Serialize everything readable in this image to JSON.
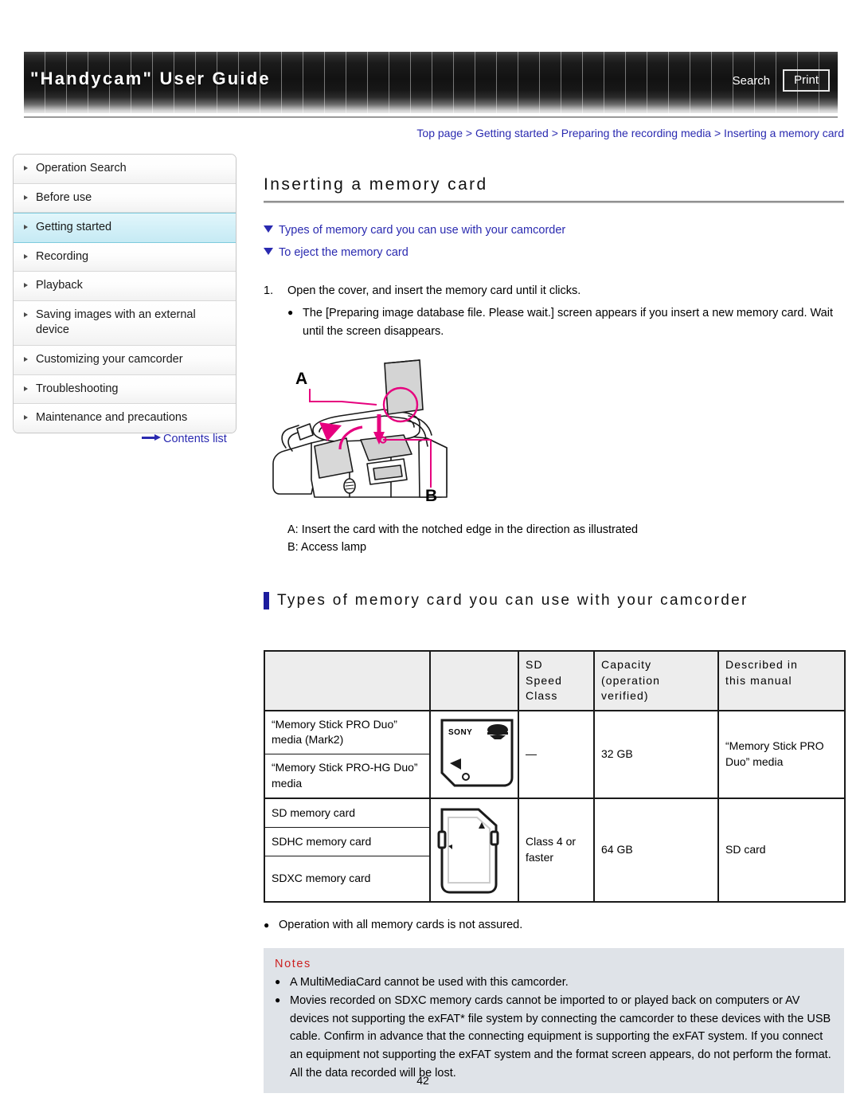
{
  "header": {
    "title": "\"Handycam\" User Guide",
    "search_label": "Search",
    "print_label": "Print"
  },
  "sidebar": {
    "items": [
      {
        "label": "Operation Search",
        "active": false
      },
      {
        "label": "Before use",
        "active": false
      },
      {
        "label": "Getting started",
        "active": true
      },
      {
        "label": "Recording",
        "active": false
      },
      {
        "label": "Playback",
        "active": false
      },
      {
        "label": "Saving images with an external device",
        "active": false
      },
      {
        "label": "Customizing your camcorder",
        "active": false
      },
      {
        "label": "Troubleshooting",
        "active": false
      },
      {
        "label": "Maintenance and precautions",
        "active": false
      }
    ],
    "contents_link": "Contents list"
  },
  "main": {
    "breadcrumb": "Top page > Getting started > Preparing the recording media > Inserting a memory card",
    "page_title": "Inserting a memory card",
    "jump_links": [
      "Types of memory card you can use with your camcorder",
      "To eject the memory card"
    ],
    "step": {
      "number": "1.",
      "text": "Open the cover, and insert the memory card until it clicks.",
      "bullets": [
        "The [Preparing image database file. Please wait.] screen appears if you insert a new memory card. Wait until the screen disappears."
      ]
    },
    "figure": {
      "label_a": "A",
      "label_b": "B"
    },
    "legend": [
      "A: Insert the card with the notched edge in the direction as illustrated",
      "B: Access lamp"
    ],
    "section_title": "Types of memory card you can use with your camcorder",
    "table": {
      "headers": [
        "",
        "",
        "SD Speed Class",
        "Capacity (operation verified)",
        "Described in this manual"
      ],
      "header_lines": {
        "sd_speed_class": [
          "SD",
          "Speed",
          "Class"
        ],
        "capacity": [
          "Capacity",
          "(operation",
          "verified)"
        ],
        "described": [
          "Described in",
          "this manual"
        ]
      },
      "rows": [
        {
          "names": [
            "“Memory Stick PRO Duo” media (Mark2)",
            "“Memory Stick PRO-HG Duo” media"
          ],
          "image": "memory-stick-pro-duo-card",
          "image_brand": "SONY",
          "sd_speed_class": "—",
          "capacity": "32 GB",
          "described": "“Memory Stick PRO Duo” media"
        },
        {
          "names": [
            "SD memory card",
            "SDHC memory card",
            "SDXC memory card"
          ],
          "image": "sd-card",
          "image_brand": "",
          "sd_speed_class": "Class 4 or faster",
          "capacity": "64 GB",
          "described": "SD card"
        }
      ]
    },
    "table_note": "Operation with all memory cards is not assured.",
    "notes": {
      "title": "Notes",
      "items": [
        "A MultiMediaCard cannot be used with this camcorder.",
        "Movies recorded on SDXC memory cards cannot be imported to or played back on computers or AV devices not supporting the exFAT* file system by connecting the camcorder to these devices with the USB cable. Confirm in advance that the connecting equipment is supporting the exFAT system. If you connect an equipment not supporting the exFAT system and the format screen appears, do not perform the format. All the data recorded will be lost."
      ]
    },
    "page_number": "42"
  },
  "colors": {
    "link": "#2a2ab0",
    "active_sidebar": "#c6eaf4",
    "section_bar": "#1c1c9e",
    "notes_title": "#cc2121",
    "notes_bg": "#dfe3e8",
    "illustration_accent": "#e6007e"
  }
}
